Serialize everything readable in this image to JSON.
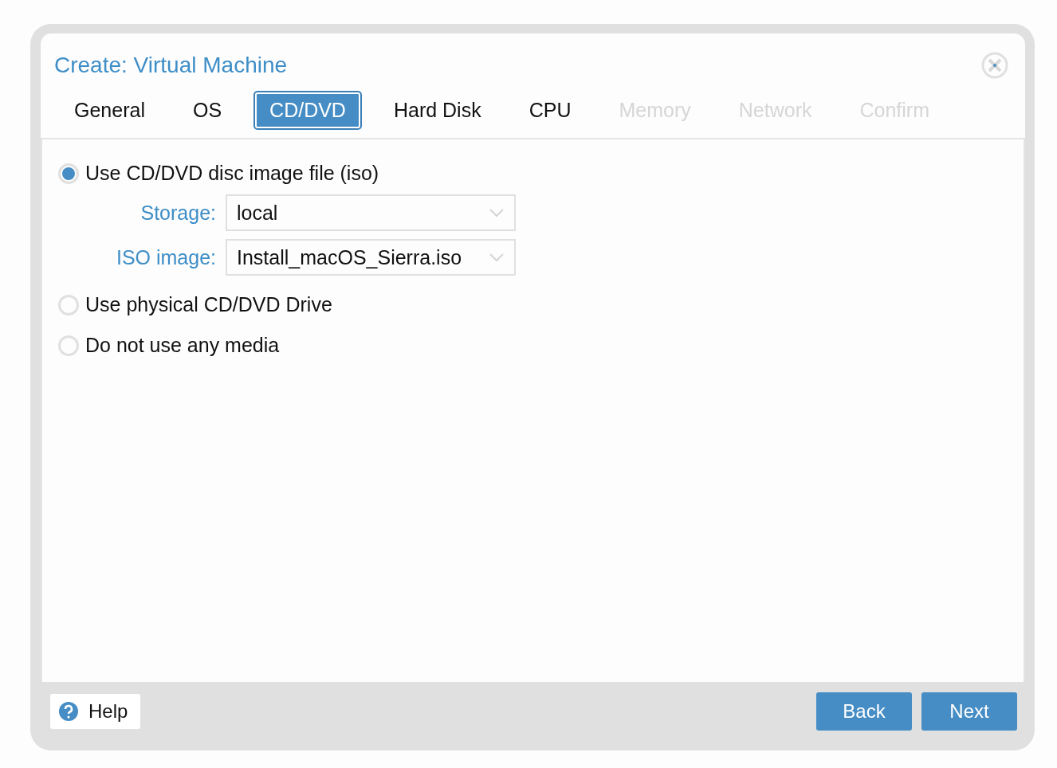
{
  "window": {
    "title": "Create: Virtual Machine"
  },
  "tabs": [
    {
      "label": "General",
      "selected": false,
      "disabled": false
    },
    {
      "label": "OS",
      "selected": false,
      "disabled": false
    },
    {
      "label": "CD/DVD",
      "selected": true,
      "disabled": false
    },
    {
      "label": "Hard Disk",
      "selected": false,
      "disabled": false
    },
    {
      "label": "CPU",
      "selected": false,
      "disabled": false
    },
    {
      "label": "Memory",
      "selected": false,
      "disabled": true
    },
    {
      "label": "Network",
      "selected": false,
      "disabled": true
    },
    {
      "label": "Confirm",
      "selected": false,
      "disabled": true
    }
  ],
  "options": [
    {
      "label": "Use CD/DVD disc image file (iso)",
      "selected": true,
      "fields": [
        {
          "label": "Storage:",
          "value": "local"
        },
        {
          "label": "ISO image:",
          "value": "Install_macOS_Sierra.iso"
        }
      ]
    },
    {
      "label": "Use physical CD/DVD Drive",
      "selected": false
    },
    {
      "label": "Do not use any media",
      "selected": false
    }
  ],
  "footer": {
    "help": "Help",
    "buttons": [
      "Back",
      "Next"
    ]
  }
}
